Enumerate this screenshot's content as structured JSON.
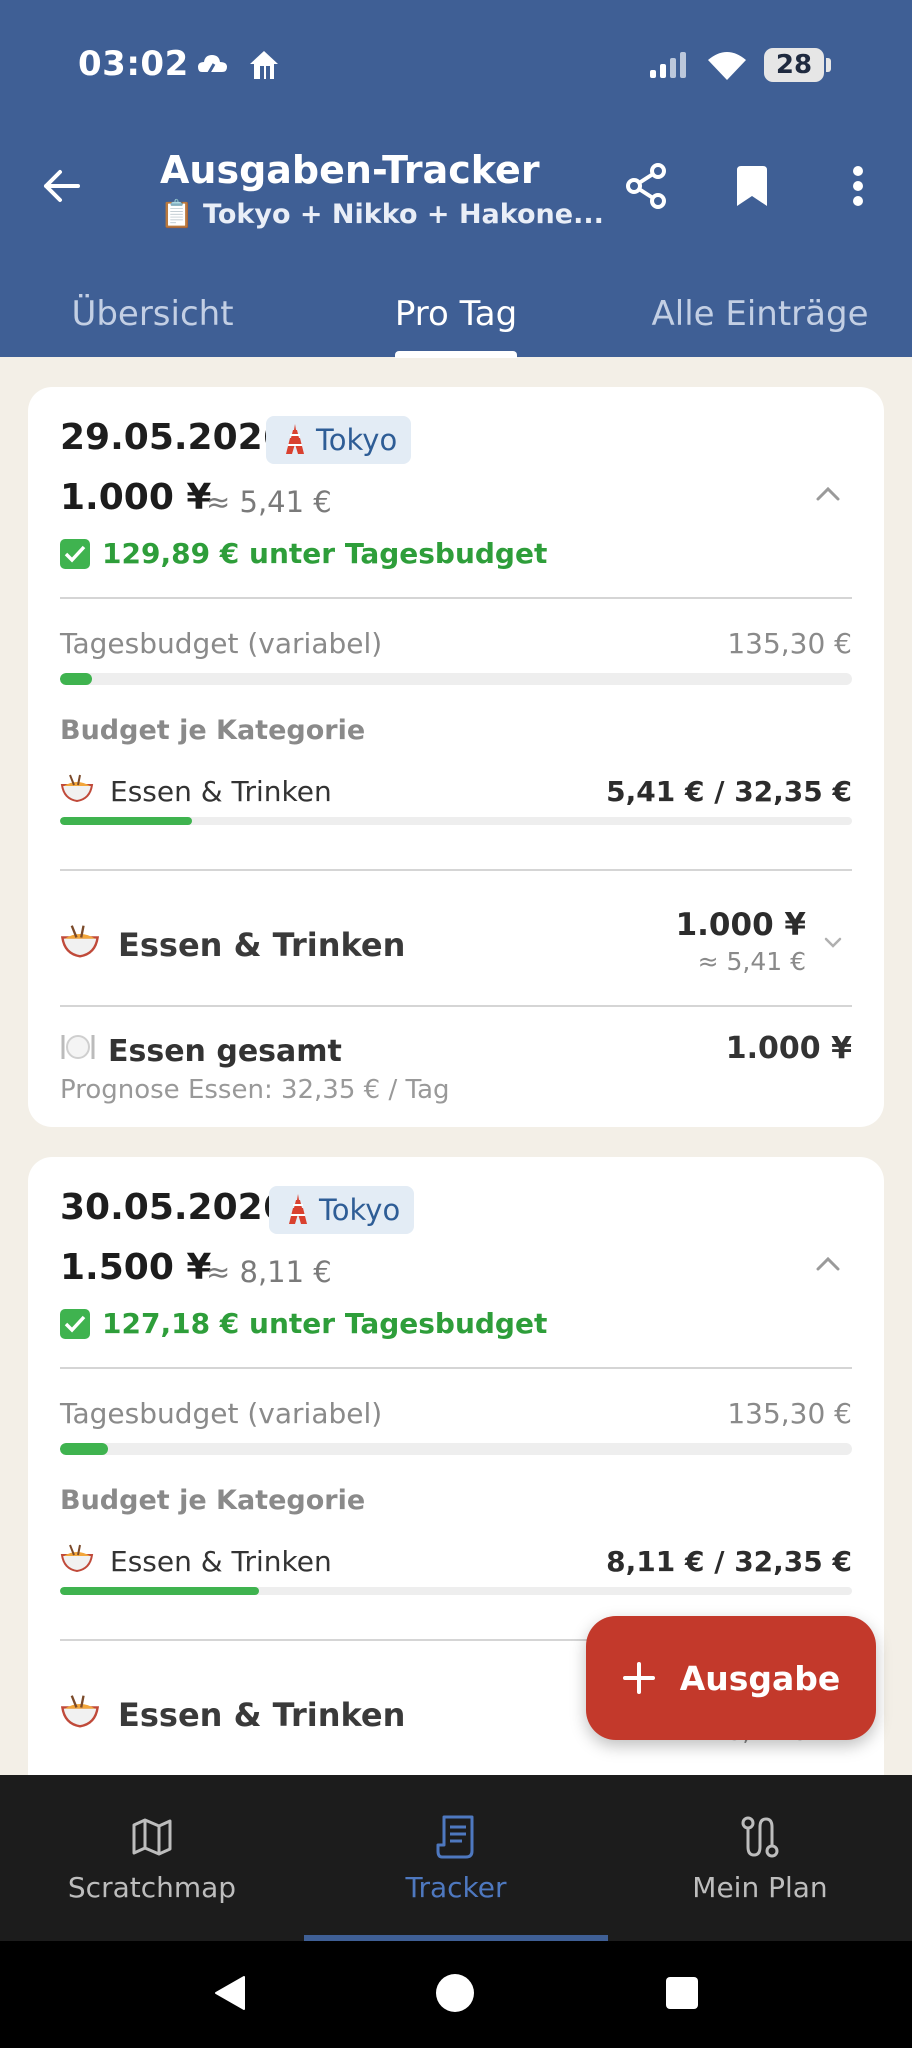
{
  "status_bar": {
    "time": "03:02",
    "battery": "28"
  },
  "header": {
    "title": "Ausgaben-Tracker",
    "subtitle": "📋 Tokyo + Nikko + Hakone..."
  },
  "tabs": [
    {
      "label": "Übersicht",
      "active": false
    },
    {
      "label": "Pro Tag",
      "active": true
    },
    {
      "label": "Alle Einträge",
      "active": false
    }
  ],
  "days": [
    {
      "date": "29.05.2026",
      "city": "Tokyo",
      "total": "1.000 ¥",
      "approx": "≈ 5,41 €",
      "under_budget": "129,89 € unter Tagesbudget",
      "budget_label": "Tagesbudget (variabel)",
      "budget_value": "135,30 €",
      "budget_progress": 0.04,
      "category_heading": "Budget je Kategorie",
      "category_label": "Essen & Trinken",
      "category_amount": "5,41 € / 32,35 €",
      "category_progress": 0.167,
      "group_label": "Essen & Trinken",
      "group_amount": "1.000 ¥",
      "group_approx": "≈ 5,41 €",
      "food_label": "Essen gesamt",
      "food_amount": "1.000 ¥",
      "prognose": "Prognose Essen: 32,35 € / Tag"
    },
    {
      "date": "30.05.2026",
      "city": "Tokyo",
      "total": "1.500 ¥",
      "approx": "≈ 8,11 €",
      "under_budget": "127,18 € unter Tagesbudget",
      "budget_label": "Tagesbudget (variabel)",
      "budget_value": "135,30 €",
      "budget_progress": 0.06,
      "category_heading": "Budget je Kategorie",
      "category_label": "Essen & Trinken",
      "category_amount": "8,11 € / 32,35 €",
      "category_progress": 0.251,
      "group_label": "Essen & Trinken",
      "group_approx": "≈ 8,11 €"
    }
  ],
  "fab": {
    "label": "Ausgabe"
  },
  "bottom_nav": [
    {
      "label": "Scratchmap",
      "icon": "map-icon",
      "active": false
    },
    {
      "label": "Tracker",
      "icon": "receipt-icon",
      "active": true
    },
    {
      "label": "Mein Plan",
      "icon": "route-icon",
      "active": false
    }
  ],
  "colors": {
    "header": "#3f5f95",
    "success": "#3fb34f",
    "fab": "#c3392b",
    "nav_active": "#4e78bf"
  }
}
